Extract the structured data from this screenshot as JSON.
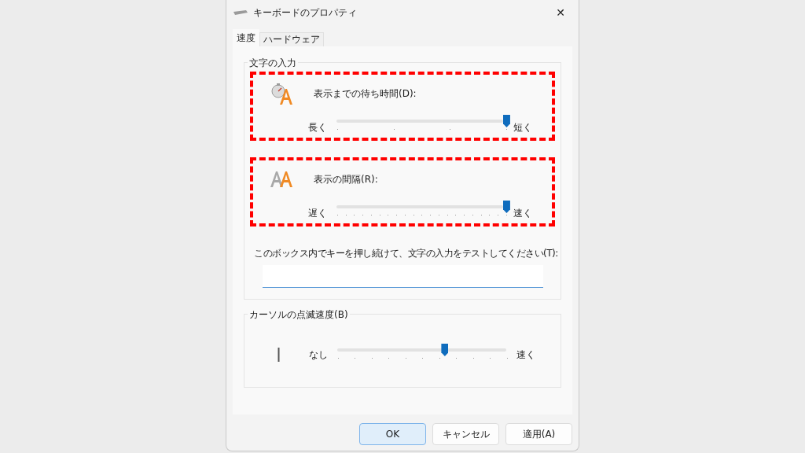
{
  "window": {
    "title": "キーボードのプロパティ",
    "close": "✕"
  },
  "tabs": [
    {
      "label": "速度",
      "selected": true
    },
    {
      "label": "ハードウェア",
      "selected": false
    }
  ],
  "groups": [
    {
      "title": "文字の入力",
      "sliders": [
        {
          "kind": "delay",
          "label": "表示までの待ち時間(D):",
          "min_label": "長く",
          "max_label": "短く",
          "level": 1.0,
          "highlighted": true
        },
        {
          "kind": "rate",
          "label": "表示の間隔(R):",
          "min_label": "遅く",
          "max_label": "速く",
          "level": 1.0,
          "highlighted": true
        }
      ],
      "test": {
        "label": "このボックス内でキーを押し続けて、文字の入力をテストしてください(T):"
      }
    },
    {
      "title": "カーソルの点滅速度(B)",
      "sliders": [
        {
          "kind": "blink",
          "min_label": "なし",
          "max_label": "速く",
          "level": 0.63,
          "highlighted": false
        }
      ]
    }
  ],
  "buttons": [
    {
      "label": "OK",
      "default": true
    },
    {
      "label": "キャンセル",
      "default": false
    },
    {
      "label": "適用(A)",
      "default": false
    }
  ]
}
